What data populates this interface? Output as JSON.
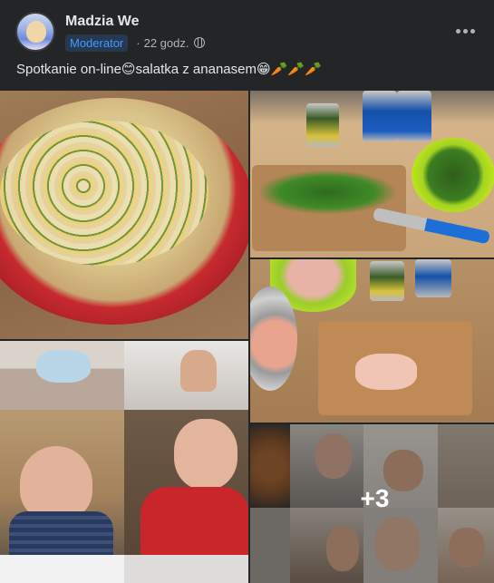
{
  "post": {
    "author": "Madzia We",
    "badge": "Moderator",
    "separator": "·",
    "time": "22 godz.",
    "privacy_icon": "globe-icon",
    "more_icon": "more-dots-icon",
    "text": "Spotkanie on-line😊salatka z ananasem😁🥕🥕🥕"
  },
  "gallery": {
    "photos": [
      "pasta-salad-bowl-photo",
      "cutting-parsley-photo",
      "chicken-cutting-photo",
      "video-call-collage-photo",
      "video-call-grid-photo"
    ],
    "more_count": "+3"
  },
  "colors": {
    "background": "#242526",
    "text_primary": "#e4e6eb",
    "text_secondary": "#b0b3b8",
    "badge_bg": "#263951",
    "badge_text": "#4599ff"
  }
}
